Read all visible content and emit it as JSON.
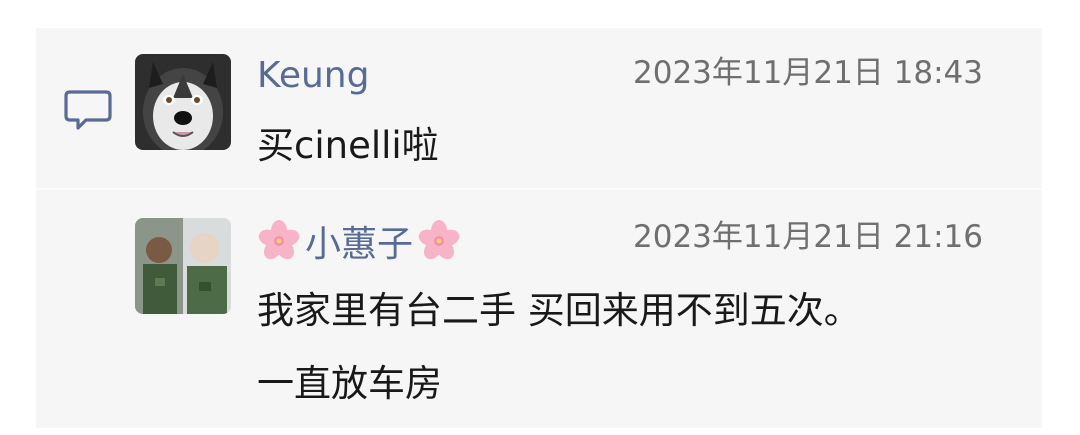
{
  "comments": [
    {
      "author": "Keung",
      "time": "2023年11月21日 18:43",
      "lines": [
        "买cinelli啦"
      ]
    },
    {
      "author": "小蕙子",
      "time": "2023年11月21日 21:16",
      "lines": [
        "我家里有台二手 买回来用不到五次。",
        "一直放车房"
      ]
    }
  ],
  "icons": {
    "comment": "comment-bubble-icon",
    "name_decoration": "cherry-blossom-icon"
  },
  "colors": {
    "author_name": "#576b95",
    "panel_background": "#f6f6f6",
    "timestamp": "#6f6f6f",
    "body_text": "#191919"
  }
}
